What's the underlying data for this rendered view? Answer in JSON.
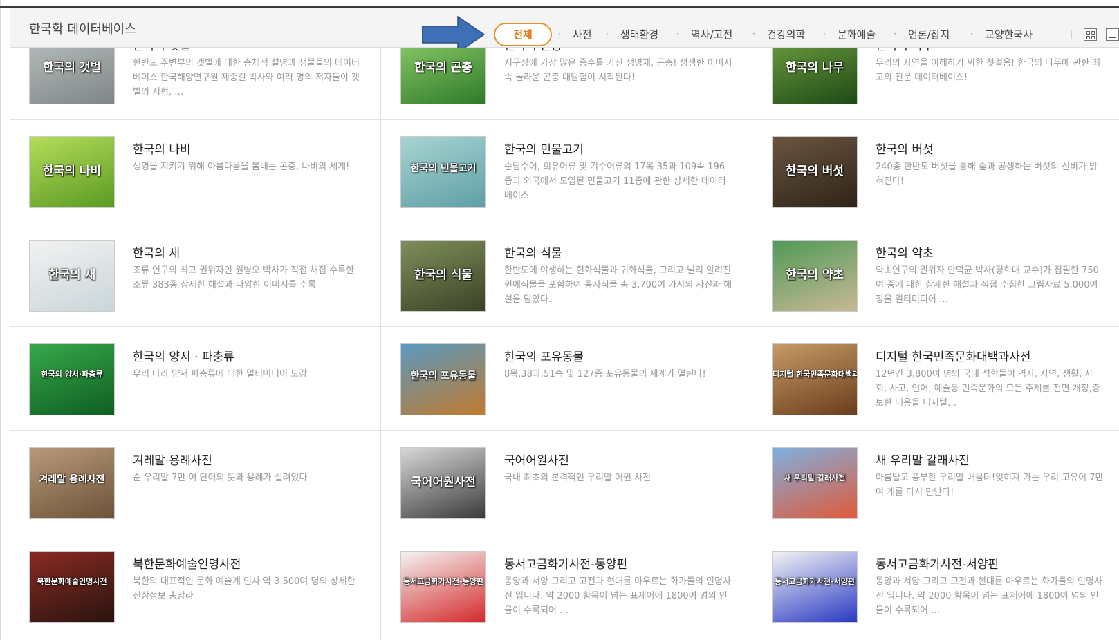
{
  "header": {
    "title": "한국학 데이터베이스",
    "active_tab": "전체",
    "tabs": [
      "사전",
      "생태환경",
      "역사/고전",
      "건강의학",
      "문화예술",
      "언론/잡지",
      "교양한국사"
    ],
    "accent_color": "#e8922b",
    "arrow_color": "#3f6fb5"
  },
  "cards": [
    {
      "name": "한국의 갯벌",
      "thumb_title": "한국의 갯벌",
      "desc": "한반도 주변부의 갯벌에 대한 총체적 설명과 생물들의 데이터베이스 한국해양연구원 제종길 박사와 여러 명의 저자들이 갯벌의 지형, …",
      "thumb_colors": [
        "#b9bfbf",
        "#7e8787"
      ]
    },
    {
      "name": "한국의 곤충",
      "thumb_title": "한국의 곤충",
      "desc": "지구상에 가장 많은 종수를 가진 생명체, 곤충! 생생한 이미지 속 놀라운 곤충 대탐험이 시작된다!",
      "thumb_colors": [
        "#8fcf6a",
        "#2f7a2a"
      ]
    },
    {
      "name": "한국의 나무",
      "thumb_title": "한국의 나무",
      "desc": "우리의 자연을 이해하기 위한 첫걸음! 한국의 나무에 관한 최고의 전문 데이터베이스!",
      "thumb_colors": [
        "#6fa040",
        "#1f4a16"
      ]
    },
    {
      "name": "한국의 나비",
      "thumb_title": "한국의 나비",
      "desc": "생명을 지키기 위해 아름다움을 뽐내는 곤충, 나비의 세계!",
      "thumb_colors": [
        "#b5dc5a",
        "#5a9a22"
      ]
    },
    {
      "name": "한국의 민물고기",
      "thumb_title": "한국의 민물고기",
      "desc": "순담수어, 회유어류 및 기수어류의 17목 35과 109속 196종과 외국에서 도입된 민물고기 11종에 관한 상세한 데이터베이스",
      "thumb_colors": [
        "#a8d4d2",
        "#5e9fa5"
      ]
    },
    {
      "name": "한국의 버섯",
      "thumb_title": "한국의 버섯",
      "desc": "240종 한반도 버섯을 통해 숲과 공생하는 버섯의 신비가 밝혀진다!",
      "thumb_colors": [
        "#6a5540",
        "#2e2418"
      ]
    },
    {
      "name": "한국의 새",
      "thumb_title": "한국의 새",
      "desc": "조류 연구의 최고 권위자인 원병오 박사가 직접 채집 수록한 조류 383종 상세한 해설과 다양한 이미지를 수록",
      "thumb_colors": [
        "#f2f2f2",
        "#c9d6d9"
      ]
    },
    {
      "name": "한국의 식물",
      "thumb_title": "한국의 식물",
      "desc": "한반도에 야생하는 현화식물과 귀화식물, 그리고 널리 알려진 원예식물을 포함하여 종자식물 총 3,700여 가지의 사진과 해설을 담았다.",
      "thumb_colors": [
        "#7f8f5a",
        "#3a4226"
      ]
    },
    {
      "name": "한국의 약초",
      "thumb_title": "한국의 약초",
      "desc": "약초연구의 권위자 안덕균 박사(경희대 교수)가 집필한 750여 종에 대한 상세한 해설과 직접 수집한 그림자료 5,000여 장을 멀티미디어 …",
      "thumb_colors": [
        "#4f9a56",
        "#c9b896"
      ]
    },
    {
      "name": "한국의 양서 · 파충류",
      "thumb_title": "한국의 양서·파충류",
      "desc": "우리 나라 양서 파충류에 대한 멀티미디어 도감",
      "thumb_colors": [
        "#36a84a",
        "#0f5e22"
      ]
    },
    {
      "name": "한국의 포유동물",
      "thumb_title": "한국의 포유동물",
      "desc": "8목,38과,51속 및 127종 포유동물의 세계가 열린다!",
      "thumb_colors": [
        "#5a9ac0",
        "#c07a2e"
      ]
    },
    {
      "name": "디지털 한국민족문화대백과사전",
      "thumb_title": "디지털 한국민족문화대백과사전",
      "desc": "12년간 3,800여 명의 국내 석학들이 역사, 자연, 생활, 사회, 사고, 언어, 예술등 민족문화의 모든 주제를 전면 개정,증보한 내용을 디지털…",
      "thumb_colors": [
        "#c79a66",
        "#6a3e1c"
      ]
    },
    {
      "name": "겨레말 용례사전",
      "thumb_title": "겨레말 용례사전",
      "desc": "순 우리말 7만 여 단어의 뜻과 용례가 실려있다",
      "thumb_colors": [
        "#b89a7a",
        "#6e5238"
      ]
    },
    {
      "name": "국어어원사전",
      "thumb_title": "국어어원사전",
      "desc": "국내 최초의 본격적인 우리말 어원 사전",
      "thumb_colors": [
        "#d8d8d8",
        "#3a3a3a"
      ]
    },
    {
      "name": "새 우리말 갈래사전",
      "thumb_title": "새 우리말 갈래사전",
      "desc": "아름답고 풍부한 우리말 배움터!잊혀져 가는 우리 고유어 7만여 개를 다시 만난다!",
      "thumb_colors": [
        "#7fb0e0",
        "#e05a3a"
      ]
    },
    {
      "name": "북한문화예술인명사전",
      "thumb_title": "북한문화예술인명사전",
      "desc": "북한의 대표적인 문화 예술계 인사 약 3,500여 명의 상세한 신상정보 총망라",
      "thumb_colors": [
        "#8a2a22",
        "#2a1410"
      ]
    },
    {
      "name": "동서고금화가사전-동양편",
      "thumb_title": "동서고금화가사전-동양편",
      "desc": "동양과 서양 그리고 고전과 현대를 아우르는 화가들의 인명사전 입니다. 약 2000 항목이 넘는 표제어에 1800여 명의 인물이 수록되어 …",
      "thumb_colors": [
        "#f4f4f4",
        "#d42a2a"
      ]
    },
    {
      "name": "동서고금화가사전-서양편",
      "thumb_title": "동서고금화가사전-서양편",
      "desc": "동양과 서양 그리고 고전과 현대를 아우르는 화가들의 인명사전 입니다. 약 2000 항목이 넘는 표제어에 1800여 명의 인물이 수록되어 …",
      "thumb_colors": [
        "#f4f4f4",
        "#2a3ac4"
      ]
    }
  ]
}
